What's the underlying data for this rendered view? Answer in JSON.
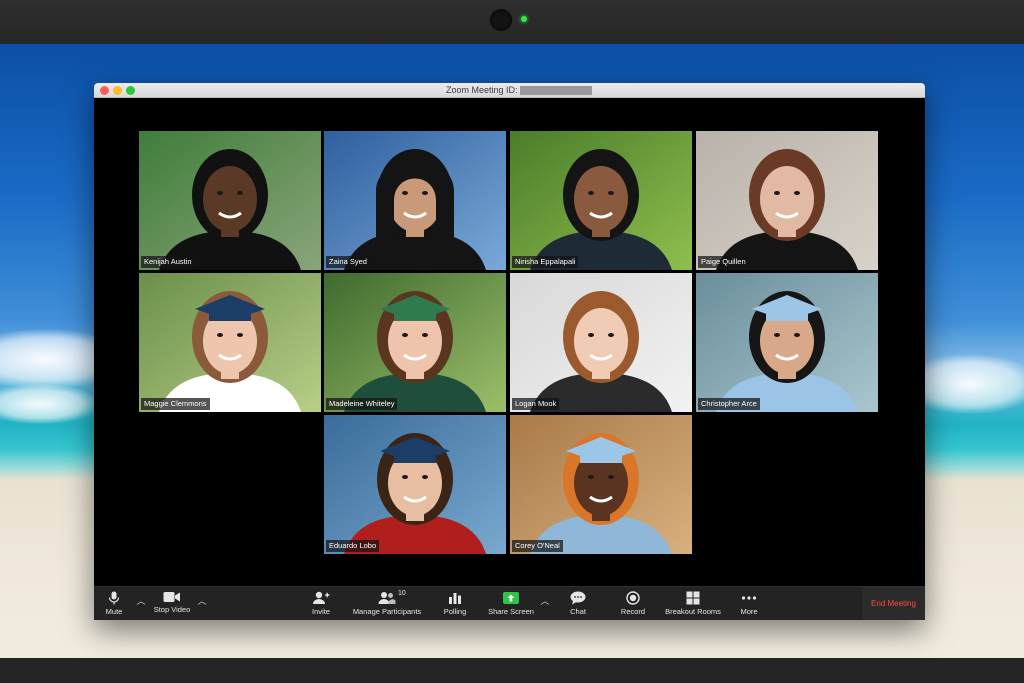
{
  "window": {
    "title": "Zoom Meeting ID:"
  },
  "participants": [
    {
      "name": "Kenijah Austin",
      "skin": "#5a3a26",
      "hair": "#111111",
      "bg1": "#3f7d3a",
      "bg2": "#8aa57a",
      "cloth": "#111111",
      "cap": "none"
    },
    {
      "name": "Zaina Syed",
      "skin": "#c99a7a",
      "hair": "#141414",
      "bg1": "#2f5f9e",
      "bg2": "#7aa9d8",
      "cloth": "#141414",
      "cap": "hijab"
    },
    {
      "name": "Nirisha Eppalapali",
      "skin": "#8a5a3e",
      "hair": "#141414",
      "bg1": "#4a7d2a",
      "bg2": "#8fbf4e",
      "cloth": "#1e2a36",
      "cap": "none"
    },
    {
      "name": "Paige Quillen",
      "skin": "#e2b9a3",
      "hair": "#6a3a26",
      "bg1": "#b9b2aa",
      "bg2": "#d8d2c8",
      "cloth": "#141414",
      "cap": "none"
    },
    {
      "name": "Maggie Clemmons",
      "skin": "#eec6ae",
      "hair": "#8a5a3a",
      "bg1": "#6a8f4a",
      "bg2": "#b8cf88",
      "cloth": "#ffffff",
      "cap": "navy"
    },
    {
      "name": "Madeleine Whiteley",
      "skin": "#efc4ac",
      "hair": "#5a3620",
      "bg1": "#3e6a2e",
      "bg2": "#9cbf6a",
      "cloth": "#1f4e3a",
      "cap": "green"
    },
    {
      "name": "Logan Mook",
      "skin": "#f0cbb5",
      "hair": "#9a5a2e",
      "bg1": "#d8d8d8",
      "bg2": "#f2f2f2",
      "cloth": "#2a2a2a",
      "cap": "none"
    },
    {
      "name": "Christopher Arce",
      "skin": "#d9a888",
      "hair": "#161616",
      "bg1": "#6a8f9a",
      "bg2": "#a9c6cf",
      "cloth": "#9cc4e6",
      "cap": "lightblue"
    },
    {
      "name": "Eduardo Lobo",
      "skin": "#e8bea3",
      "hair": "#3a2416",
      "bg1": "#3a6c9a",
      "bg2": "#7aa9cf",
      "cloth": "#b01e1e",
      "cap": "navy"
    },
    {
      "name": "Corey O'Neal",
      "skin": "#5a3420",
      "hair": "#d9762a",
      "bg1": "#a87a48",
      "bg2": "#d9b080",
      "cloth": "#8fb8d8",
      "cap": "lightblue"
    }
  ],
  "toolbar": {
    "mute": "Mute",
    "stop_video": "Stop Video",
    "invite": "Invite",
    "manage_participants": "Manage Participants",
    "participant_count": "10",
    "polling": "Polling",
    "share_screen": "Share Screen",
    "chat": "Chat",
    "record": "Record",
    "breakout_rooms": "Breakout Rooms",
    "more": "More",
    "end_meeting": "End Meeting"
  },
  "colors": {
    "share_green": "#2ec34a",
    "end_red": "#ff4b3e",
    "toolbar_bg": "#232323"
  }
}
